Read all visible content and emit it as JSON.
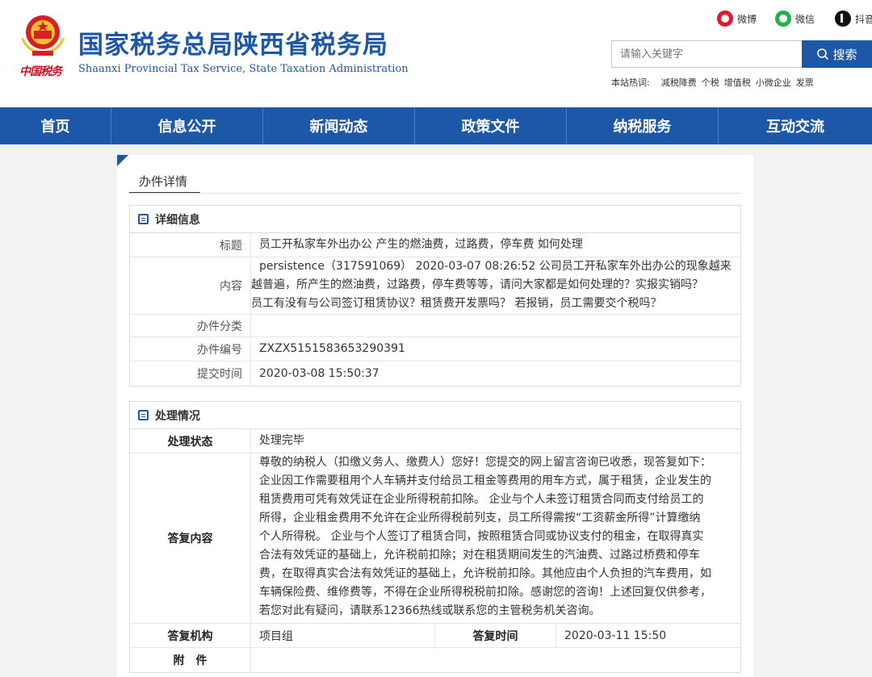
{
  "header": {
    "title": "国家税务总局陕西省税务局",
    "subtitle": "Shaanxi Provincial Tax Service, State Taxation Administration",
    "seal_text": "中国税务",
    "social": [
      {
        "label": "微博",
        "icon": "weibo-icon",
        "color": "#e6162d"
      },
      {
        "label": "微信",
        "icon": "wechat-icon",
        "color": "#22b14c"
      },
      {
        "label": "抖音",
        "icon": "douyin-icon",
        "color": "#111111"
      }
    ],
    "search": {
      "placeholder": "请输入关键字",
      "button_label": "搜索"
    },
    "hot": {
      "label": "本站热词:",
      "words": [
        "减税降费",
        "个税",
        "增值税",
        "小微企业",
        "发票"
      ]
    }
  },
  "nav": [
    {
      "label": "首页"
    },
    {
      "label": "信息公开"
    },
    {
      "label": "新闻动态"
    },
    {
      "label": "政策文件"
    },
    {
      "label": "纳税服务"
    },
    {
      "label": "互动交流"
    }
  ],
  "breadcrumb": "办件详情",
  "detail": {
    "heading": "详细信息",
    "title_label": "标题",
    "title_value": "员工开私家车外出办公 产生的燃油费，过路费，停车费 如何处理",
    "content_label": "内容",
    "content_lines": [
      "persistence（317591069） 2020-03-07 08:26:52 公司员工开私家车外出办公的现象越来",
      "越普遍，所产生的燃油费，过路费，停车费等等，请问大家都是如何处理的？实报实销吗？",
      "员工有没有与公司签订租赁协议？租赁费开发票吗？ 若报销，员工需要交个税吗？"
    ],
    "category_label": "办件分类",
    "category_value": "",
    "number_label": "办件编号",
    "number_value": "ZXZX5151583653290391",
    "time_label": "提交时间",
    "time_value": "2020-03-08 15:50:37"
  },
  "handling": {
    "heading": "处理情况",
    "status_label": "处理状态",
    "status_value": "处理完毕",
    "reply_label": "答复内容",
    "reply_lines": [
      "尊敬的纳税人（扣缴义务人、缴费人）您好！您提交的网上留言咨询已收悉，现答复如下：",
      "企业因工作需要租用个人车辆并支付给员工租金等费用的用车方式，属于租赁，企业发生的",
      "租赁费用可凭有效凭证在企业所得税前扣除。 企业与个人未签订租赁合同而支付给员工的",
      "所得，企业租金费用不允许在企业所得税前列支，员工所得需按“工资薪金所得”计算缴纳",
      "个人所得税。 企业与个人签订了租赁合同，按照租赁合同或协议支付的租金，在取得真实",
      "合法有效凭证的基础上，允许税前扣除；对在租赁期间发生的汽油费、过路过桥费和停车",
      "费，在取得真实合法有效凭证的基础上，允许税前扣除。其他应由个人负担的汽车费用，如",
      "车辆保险费、维修费等，不得在企业所得税税前扣除。感谢您的咨询！上述回复仅供参考，",
      "若您对此有疑问，请联系12366热线或联系您的主管税务机关咨询。"
    ],
    "org_label": "答复机构",
    "org_value": "项目组",
    "reply_time_label": "答复时间",
    "reply_time_value": "2020-03-11 15:50",
    "attachment_label": "附　件",
    "attachment_value": ""
  }
}
